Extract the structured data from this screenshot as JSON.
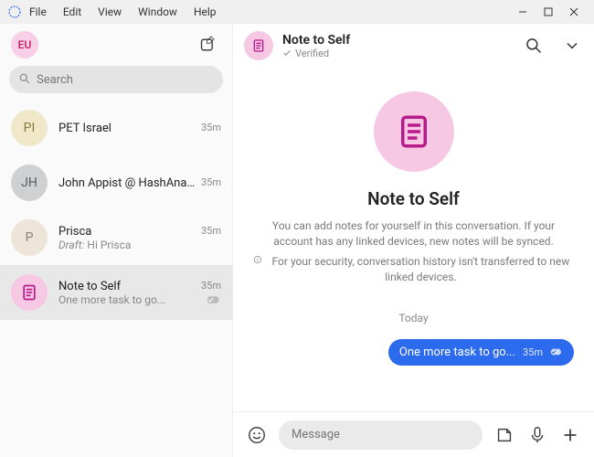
{
  "menu": {
    "file": "File",
    "edit": "Edit",
    "view": "View",
    "window": "Window",
    "help": "Help"
  },
  "profile": {
    "initials": "EU"
  },
  "search": {
    "placeholder": "Search"
  },
  "conversations": [
    {
      "avatar_text": "PI",
      "name": "PET Israel",
      "time": "35m",
      "preview": "",
      "draft": false,
      "status": ""
    },
    {
      "avatar_text": "JH",
      "name": "John Appist @ HashAnal...",
      "time": "35m",
      "preview": "",
      "draft": false,
      "status": ""
    },
    {
      "avatar_text": "P",
      "name": "Prisca",
      "time": "35m",
      "preview": "Hi Prisca",
      "draft": true,
      "draft_label": "Draft:",
      "status": ""
    },
    {
      "avatar_text": "",
      "name": "Note to Self",
      "time": "35m",
      "preview": "One more task to go...",
      "draft": false,
      "status": "delivered"
    }
  ],
  "chat": {
    "title": "Note to Self",
    "verified_label": "Verified",
    "big_title": "Note to Self",
    "description_line1": "You can add notes for yourself in this conversation. If your account has any linked devices, new notes will be synced.",
    "description_line2": "For your security, conversation history isn't transferred to new linked devices.",
    "date_separator": "Today",
    "messages": [
      {
        "text": "One more task to go...",
        "time": "35m",
        "status": "delivered",
        "outgoing": true
      }
    ]
  },
  "composer": {
    "placeholder": "Message"
  }
}
